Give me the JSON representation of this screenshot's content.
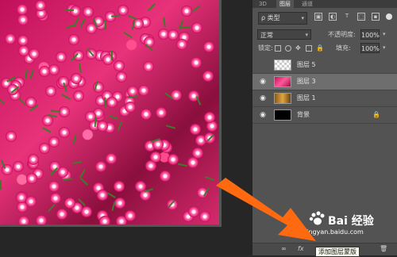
{
  "tabs": [
    "3D",
    "图层",
    "通道"
  ],
  "filter": {
    "kind_label": "ρ 类型"
  },
  "blend": {
    "mode": "正常",
    "opacity_label": "不透明度:",
    "opacity_value": "100%"
  },
  "lock": {
    "label": "锁定:",
    "fill_label": "填充:",
    "fill_value": "100%"
  },
  "layers": [
    {
      "name": "图层 5",
      "thumb": "checker",
      "visible": false
    },
    {
      "name": "图层 3",
      "thumb": "flowers",
      "visible": true,
      "selected": true
    },
    {
      "name": "图层 1",
      "thumb": "gold",
      "visible": true
    },
    {
      "name": "背景",
      "thumb": "black",
      "visible": true,
      "locked": true
    }
  ],
  "bottom": {
    "link": "∞",
    "fx": "fx",
    "trash": "🗑"
  },
  "tooltip": "添加图层蒙版",
  "watermark": {
    "brand": "Bai 经验",
    "url": "jingyan.baidu.com"
  },
  "colors": {
    "arrow": "#ff6a10",
    "panel": "#535353",
    "selected_row": "#6e6e6e"
  }
}
